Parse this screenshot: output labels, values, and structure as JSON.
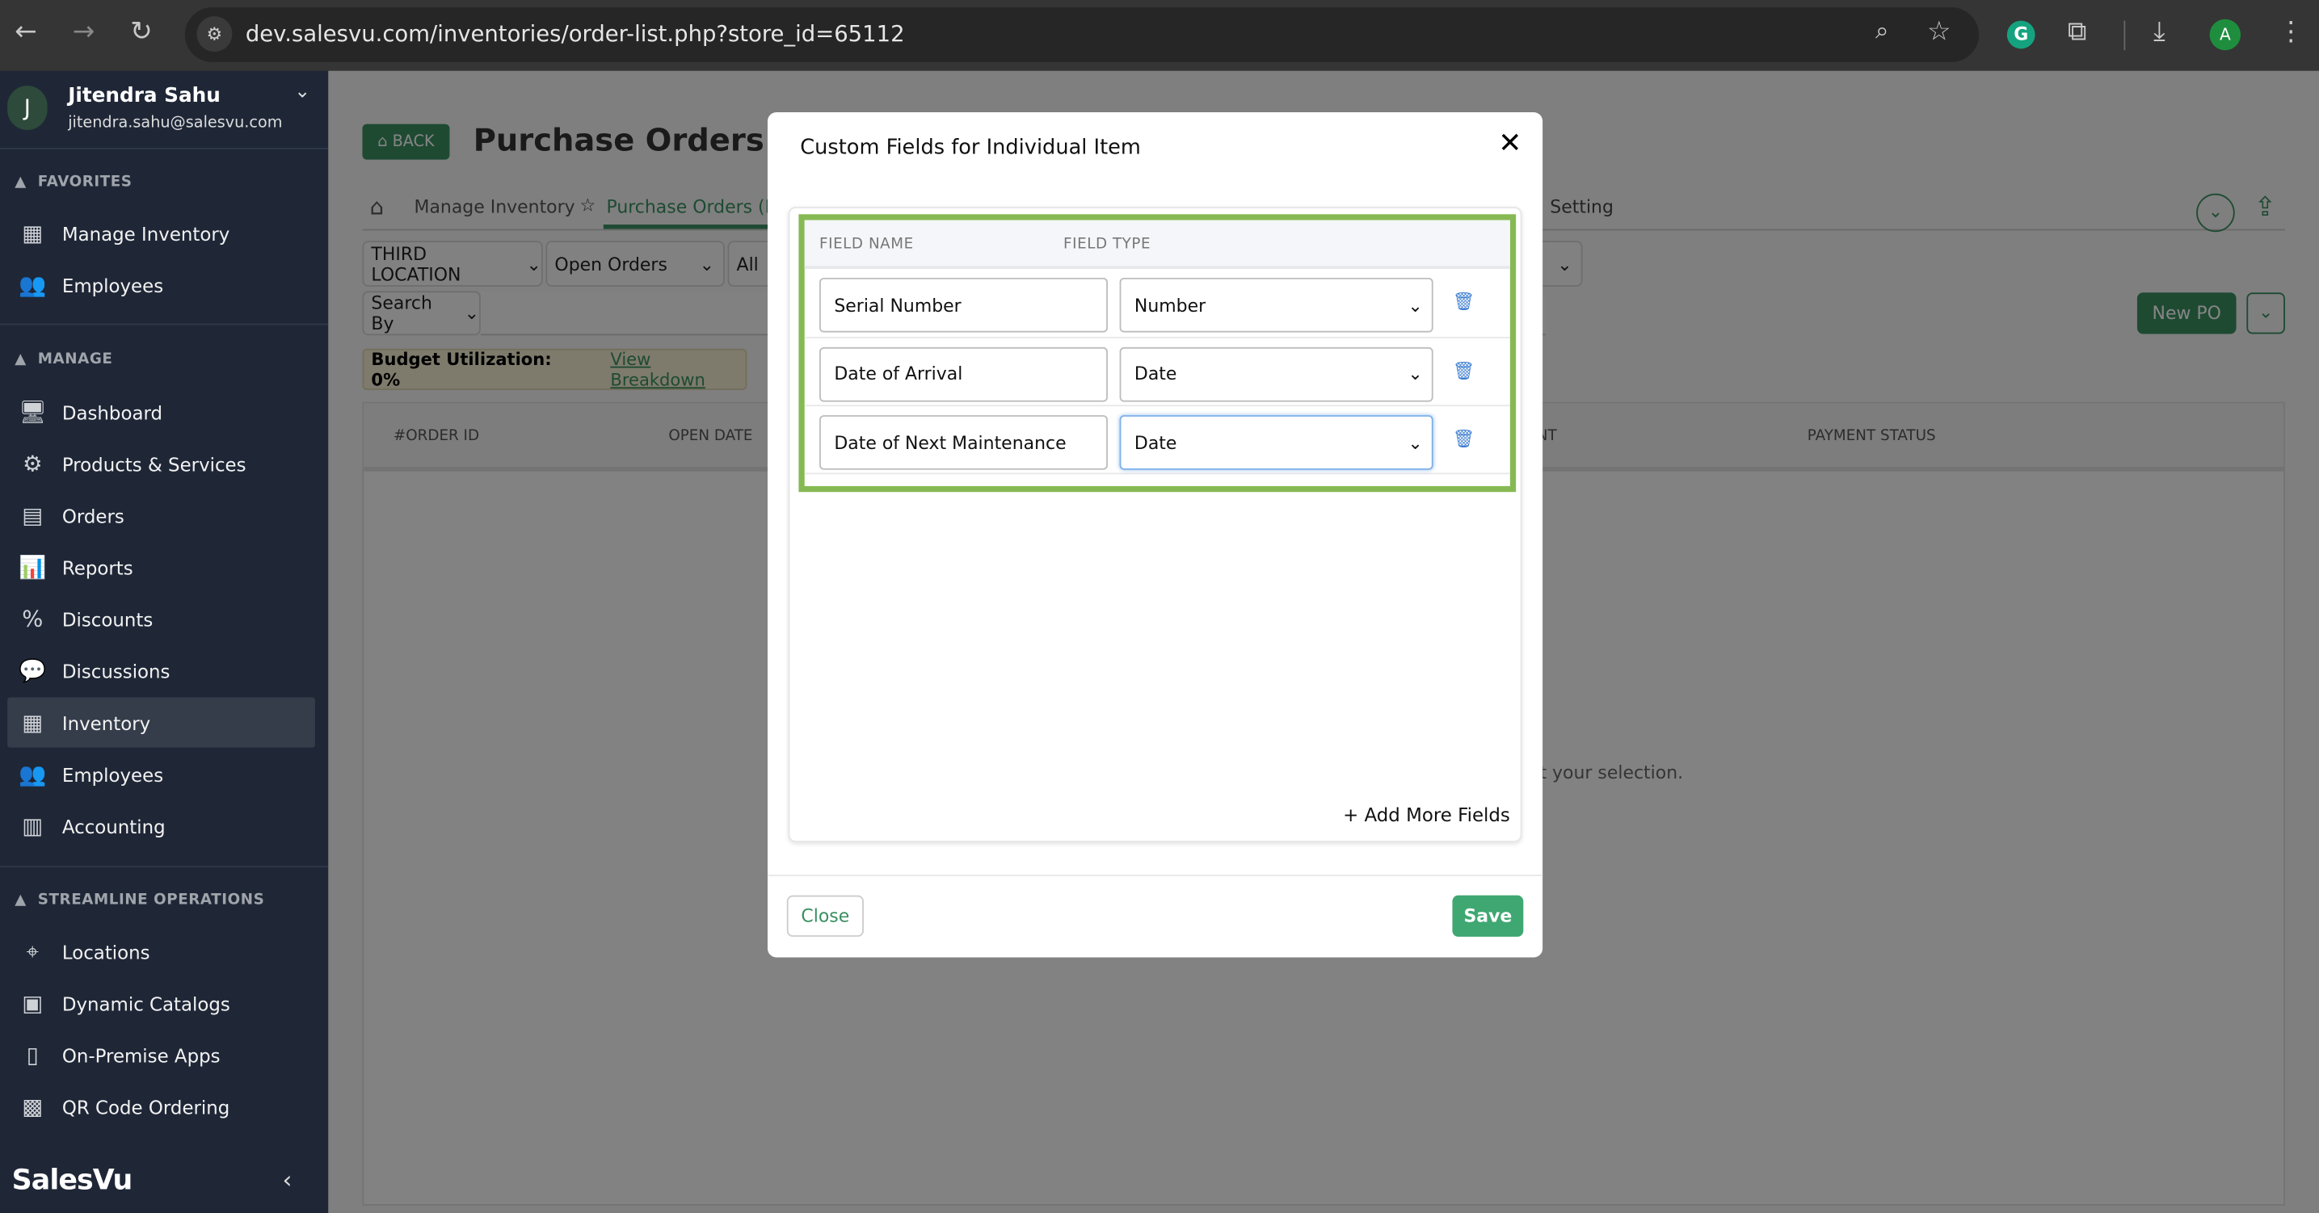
{
  "browser": {
    "url": "dev.salesvu.com/inventories/order-list.php?store_id=65112",
    "profile_initial": "A",
    "icons": [
      "back-icon",
      "forward-icon",
      "reload-icon",
      "site-settings-icon",
      "zoom-icon",
      "bookmark-star-icon",
      "grammarly-icon",
      "extensions-icon",
      "download-icon",
      "menu-icon"
    ]
  },
  "user": {
    "initial": "J",
    "name": "Jitendra Sahu",
    "email": "jitendra.sahu@salesvu.com"
  },
  "sidebar": {
    "sections": [
      {
        "title": "FAVORITES",
        "items": [
          {
            "label": "Manage Inventory",
            "icon": "inventory-icon"
          },
          {
            "label": "Employees",
            "icon": "employees-icon"
          }
        ]
      },
      {
        "title": "MANAGE",
        "items": [
          {
            "label": "Dashboard",
            "icon": "dashboard-icon"
          },
          {
            "label": "Products & Services",
            "icon": "products-icon"
          },
          {
            "label": "Orders",
            "icon": "orders-icon"
          },
          {
            "label": "Reports",
            "icon": "reports-icon"
          },
          {
            "label": "Discounts",
            "icon": "discount-icon"
          },
          {
            "label": "Discussions",
            "icon": "discussions-icon"
          },
          {
            "label": "Inventory",
            "icon": "inventory-icon",
            "active": true
          },
          {
            "label": "Employees",
            "icon": "employees-icon"
          },
          {
            "label": "Accounting",
            "icon": "accounting-icon"
          }
        ]
      },
      {
        "title": "STREAMLINE OPERATIONS",
        "items": [
          {
            "label": "Locations",
            "icon": "location-icon"
          },
          {
            "label": "Dynamic Catalogs",
            "icon": "catalog-icon"
          },
          {
            "label": "On-Premise Apps",
            "icon": "pos-terminal-icon"
          },
          {
            "label": "QR Code Ordering",
            "icon": "qr-code-icon"
          }
        ]
      }
    ],
    "logo": "SalesVu"
  },
  "page": {
    "back_label": "BACK",
    "title": "Purchase Orders (PO",
    "breadcrumb": {
      "home": "Manage Inventory",
      "active": "Purchase Orders (PO",
      "right": "Setting"
    },
    "filters": {
      "location": "THIRD LOCATION",
      "status": "Open Orders",
      "third": "All"
    },
    "search_by": "Search By",
    "new_po": "New PO",
    "budget_label": "Budget Utilization: 0%",
    "budget_link": "View Breakdown",
    "columns": [
      "#ORDER ID",
      "OPEN DATE",
      "NT",
      "PAYMENT STATUS"
    ],
    "empty_text": "t your selection."
  },
  "modal": {
    "title": "Custom Fields for Individual Item",
    "headers": {
      "name": "FIELD NAME",
      "type": "FIELD TYPE"
    },
    "rows": [
      {
        "name": "Serial Number",
        "type": "Number"
      },
      {
        "name": "Date of Arrival",
        "type": "Date"
      },
      {
        "name": "Date of Next Maintenance",
        "type": "Date",
        "focused": true
      }
    ],
    "add_more": "+ Add More Fields",
    "close": "Close",
    "save": "Save"
  },
  "colors": {
    "accent_green": "#3fa772",
    "highlight_box": "#86b953",
    "sidebar_bg": "#1f2737",
    "trash": "#3f7fd1"
  }
}
